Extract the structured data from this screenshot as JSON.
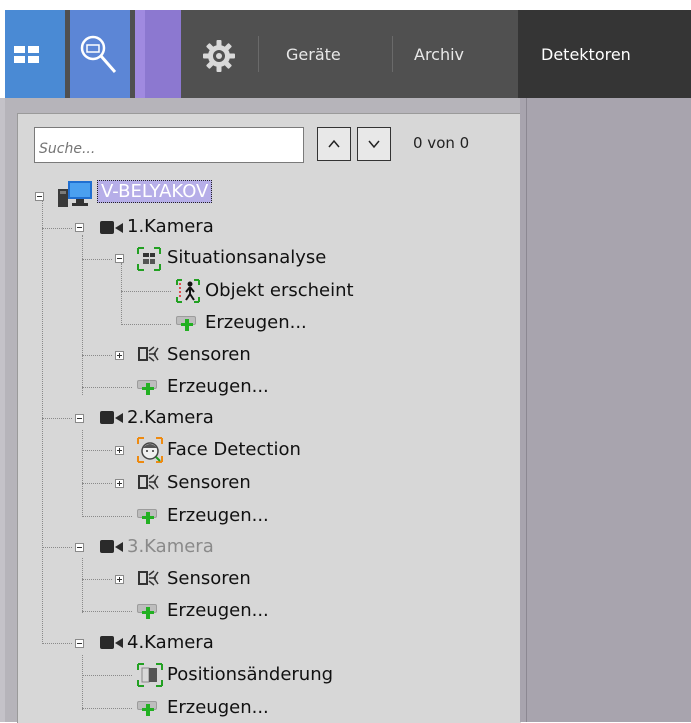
{
  "toolbar": {
    "tabs": [
      "Geräte",
      "Archiv"
    ],
    "active_tab": "Detektoren",
    "colors": {
      "layouts_button": "#4a8ad4",
      "search_button": "#5c86d6",
      "extra_button": "#8c78d0",
      "toolbar_bg": "#505050"
    },
    "icons": [
      "layouts-grid-icon",
      "archive-search-icon",
      "settings-gear-icon"
    ]
  },
  "search": {
    "placeholder": "Suche...",
    "value": "",
    "match_count": "0 von 0",
    "up_icon": "chevron-up-icon",
    "down_icon": "chevron-down-icon"
  },
  "tree": {
    "server": "V-BELYAKOV",
    "cameras": [
      {
        "label": "1.Kamera",
        "children": [
          {
            "label": "Situationsanalyse",
            "icon": "situation-analysis-icon",
            "children": [
              {
                "label": "Objekt erscheint",
                "icon": "object-appears-icon"
              },
              {
                "label": "Erzeugen...",
                "icon": "create-icon"
              }
            ]
          },
          {
            "label": "Sensoren",
            "icon": "sensors-icon"
          },
          {
            "label": "Erzeugen...",
            "icon": "create-icon"
          }
        ]
      },
      {
        "label": "2.Kamera",
        "children": [
          {
            "label": "Face Detection",
            "icon": "face-detection-icon"
          },
          {
            "label": "Sensoren",
            "icon": "sensors-icon"
          },
          {
            "label": "Erzeugen...",
            "icon": "create-icon"
          }
        ]
      },
      {
        "label": "3.Kamera",
        "disabled": true,
        "children": [
          {
            "label": "Sensoren",
            "icon": "sensors-icon"
          },
          {
            "label": "Erzeugen...",
            "icon": "create-icon"
          }
        ]
      },
      {
        "label": "4.Kamera",
        "children": [
          {
            "label": "Positionsänderung",
            "icon": "position-change-icon"
          },
          {
            "label": "Erzeugen...",
            "icon": "create-icon"
          }
        ]
      }
    ]
  }
}
